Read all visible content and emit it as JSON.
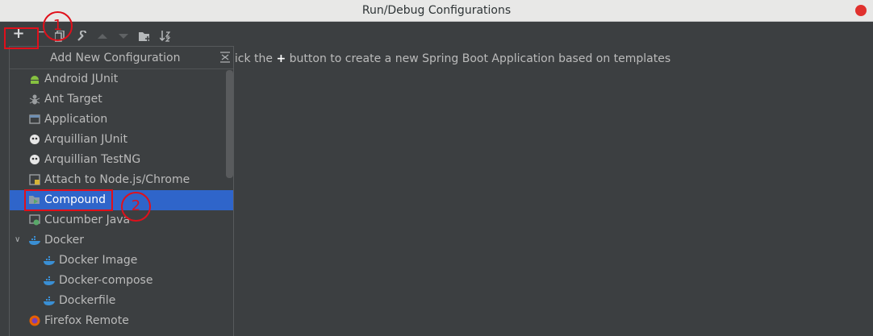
{
  "window": {
    "title": "Run/Debug Configurations"
  },
  "toolbar": {
    "add": "+",
    "remove": "−"
  },
  "hint": {
    "before": "lick the ",
    "plus": "+",
    "after": " button to create a new Spring Boot Application based on templates"
  },
  "popup": {
    "title": "Add New Configuration",
    "items": [
      {
        "label": "Android JUnit",
        "icon": "android-icon"
      },
      {
        "label": "Ant Target",
        "icon": "ant-icon"
      },
      {
        "label": "Application",
        "icon": "application-icon"
      },
      {
        "label": "Arquillian JUnit",
        "icon": "arquillian-icon"
      },
      {
        "label": "Arquillian TestNG",
        "icon": "arquillian-icon"
      },
      {
        "label": "Attach to Node.js/Chrome",
        "icon": "nodejs-icon"
      },
      {
        "label": "Compound",
        "icon": "compound-icon",
        "selected": true
      },
      {
        "label": "Cucumber Java",
        "icon": "cucumber-icon"
      },
      {
        "label": "Docker",
        "icon": "docker-icon",
        "expanded": true
      },
      {
        "label": "Docker Image",
        "icon": "docker-icon"
      },
      {
        "label": "Docker-compose",
        "icon": "docker-icon"
      },
      {
        "label": "Dockerfile",
        "icon": "docker-icon"
      },
      {
        "label": "Firefox Remote",
        "icon": "firefox-icon"
      }
    ]
  },
  "annotations": {
    "step1": "1",
    "step2": "2"
  },
  "colors": {
    "accent": "#2f65ca",
    "annotation": "#e0101b",
    "background": "#3c3f41"
  }
}
